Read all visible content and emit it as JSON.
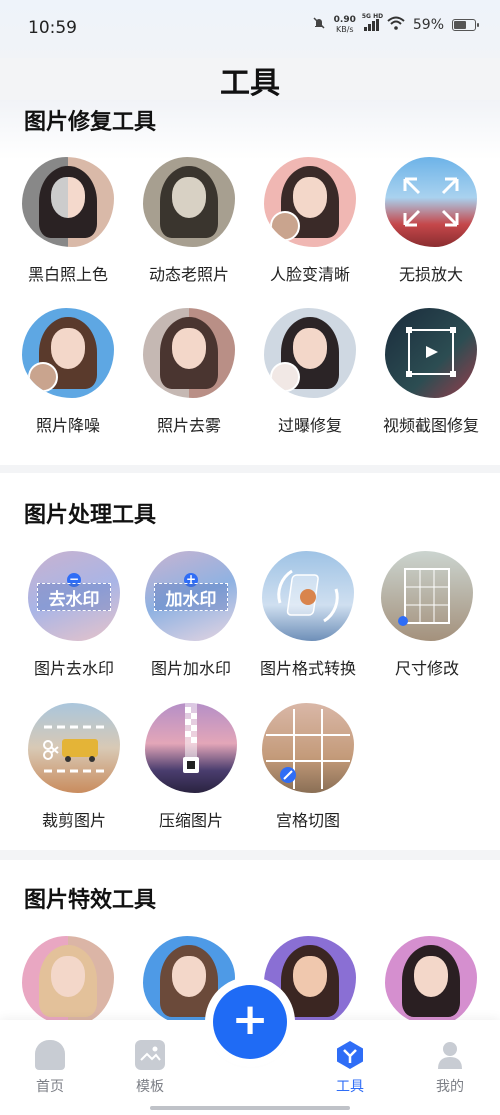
{
  "status_bar": {
    "time": "10:59",
    "speed_value": "0.90",
    "speed_unit": "KB/s",
    "network": "5G HD",
    "battery": "59%"
  },
  "header": {
    "title": "工具"
  },
  "sections": [
    {
      "title": "图片修复工具",
      "tools": [
        {
          "label": "黑白照上色"
        },
        {
          "label": "动态老照片"
        },
        {
          "label": "人脸变清晰"
        },
        {
          "label": "无损放大"
        },
        {
          "label": "照片降噪"
        },
        {
          "label": "照片去雾"
        },
        {
          "label": "过曝修复"
        },
        {
          "label": "视频截图修复"
        }
      ]
    },
    {
      "title": "图片处理工具",
      "tools": [
        {
          "label": "图片去水印",
          "overlay": "去水印"
        },
        {
          "label": "图片加水印",
          "overlay": "加水印"
        },
        {
          "label": "图片格式转换"
        },
        {
          "label": "尺寸修改"
        },
        {
          "label": "裁剪图片"
        },
        {
          "label": "压缩图片"
        },
        {
          "label": "宫格切图"
        }
      ]
    },
    {
      "title": "图片特效工具",
      "tools": []
    }
  ],
  "nav": {
    "items": [
      {
        "label": "首页",
        "icon": "home-icon"
      },
      {
        "label": "模板",
        "icon": "template-icon"
      },
      {
        "label": "工具",
        "icon": "tools-icon"
      },
      {
        "label": "我的",
        "icon": "profile-icon"
      }
    ],
    "fab": "+",
    "active_color": "#2f6df6"
  }
}
